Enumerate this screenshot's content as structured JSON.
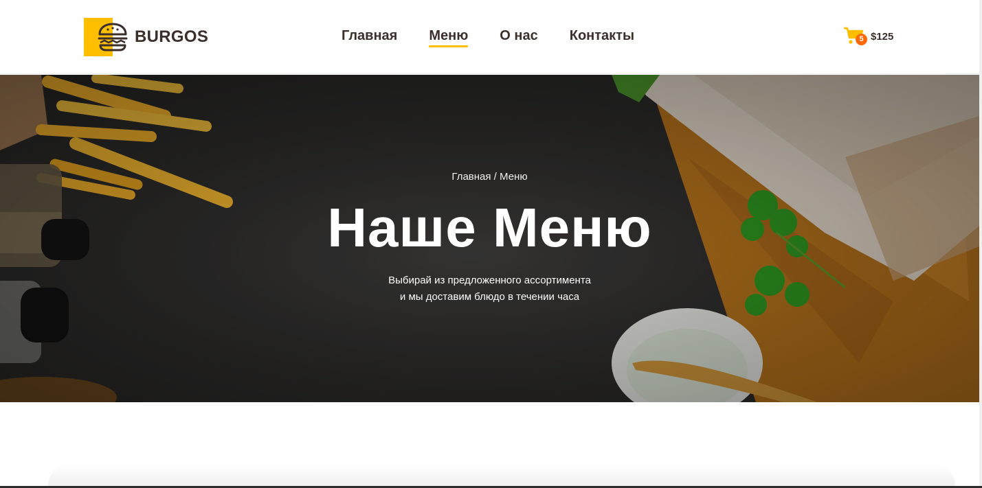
{
  "header": {
    "brand": "BURGOS",
    "nav": [
      {
        "label": "Главная",
        "active": false
      },
      {
        "label": "Меню",
        "active": true
      },
      {
        "label": "О нас",
        "active": false
      },
      {
        "label": "Контакты",
        "active": false
      }
    ],
    "cart": {
      "count": "5",
      "total": "$125"
    }
  },
  "hero": {
    "breadcrumb": {
      "home": "Главная",
      "separator": " / ",
      "current": "Меню"
    },
    "title": "Наше Меню",
    "subtitle_line1": "Выбирай из предложенного ассортимента",
    "subtitle_line2": "и мы доставим блюдо в течении часа"
  },
  "icons": {
    "logo": "burger-icon",
    "cart": "shopping-cart-icon"
  },
  "colors": {
    "accent": "#ffbe00",
    "badge": "#ff6a00",
    "text_dark": "#3a2f2b",
    "hero_bg": "#2f2e2d"
  }
}
